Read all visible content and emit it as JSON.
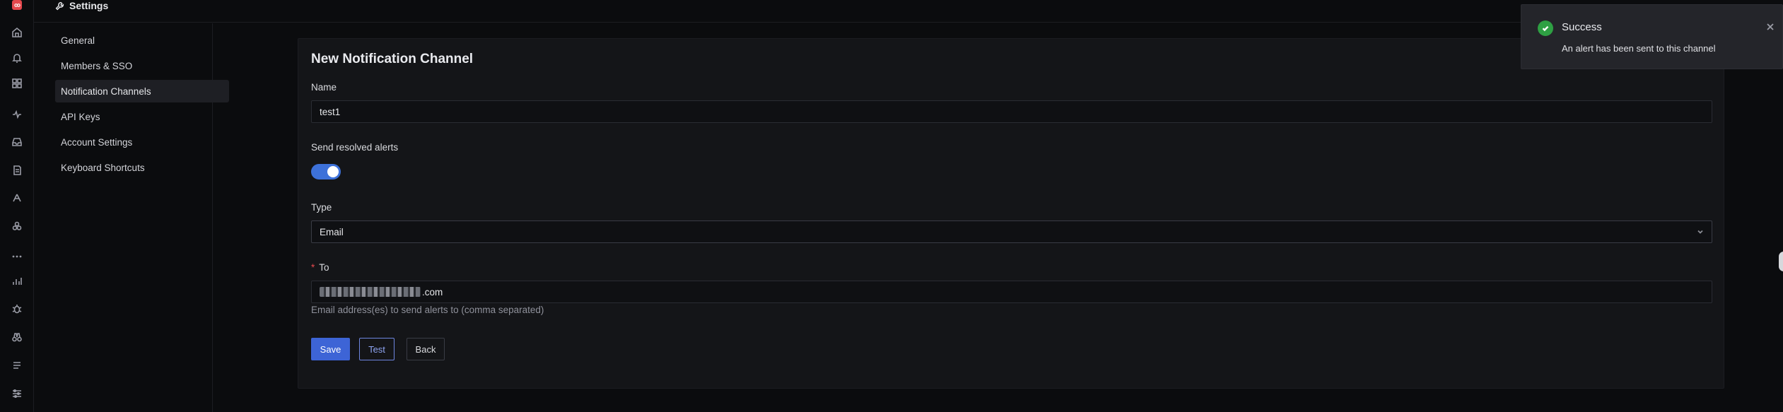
{
  "header": {
    "title": "Settings",
    "icon": "wrench-icon"
  },
  "rail": {
    "logo": "app-logo-icon",
    "icons": [
      "home-icon",
      "alert-bell-icon",
      "dashboards-icon",
      "traces-icon",
      "inbox-icon",
      "logs-icon",
      "services-icon",
      "integrations-icon",
      "more-icon",
      "metrics-icon",
      "bug-icon",
      "binoculars-icon",
      "list-icon",
      "settings-sliders-icon"
    ]
  },
  "sidenav": {
    "items": [
      {
        "label": "General"
      },
      {
        "label": "Members & SSO"
      },
      {
        "label": "Notification Channels",
        "active": true
      },
      {
        "label": "API Keys"
      },
      {
        "label": "Account Settings"
      },
      {
        "label": "Keyboard Shortcuts"
      }
    ]
  },
  "form": {
    "title": "New Notification Channel",
    "name_label": "Name",
    "name_value": "test1",
    "resolved_label": "Send resolved alerts",
    "resolved_enabled": true,
    "type_label": "Type",
    "type_value": "Email",
    "to_required_marker": "*",
    "to_label": "To",
    "to_value_suffix": ".com",
    "to_helper": "Email address(es) to send alerts to (comma separated)",
    "save_label": "Save",
    "test_label": "Test",
    "back_label": "Back"
  },
  "toast": {
    "title": "Success",
    "message": "An alert has been sent to this channel",
    "status_color": "#2ea043"
  },
  "colors": {
    "accent": "#3d64d6",
    "background": "#0b0c0e",
    "card": "#141518"
  }
}
